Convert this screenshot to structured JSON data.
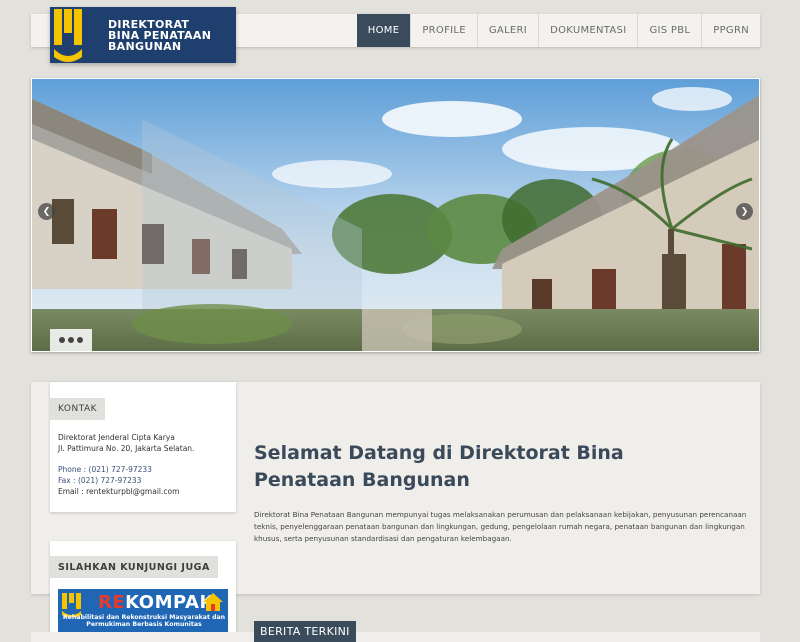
{
  "logo": {
    "line1": "DIREKTORAT",
    "line2": "BINA PENATAAN",
    "line3": "BANGUNAN",
    "colors": {
      "bg": "#1f3f6e",
      "mark": "#f5c400"
    }
  },
  "nav": {
    "items": [
      {
        "label": "HOME",
        "active": true
      },
      {
        "label": "PROFILE"
      },
      {
        "label": "GALERI"
      },
      {
        "label": "DOKUMENTASI"
      },
      {
        "label": "GIS PBL"
      },
      {
        "label": "PPGRN"
      }
    ]
  },
  "slider": {
    "prev_icon": "chevron-left-icon",
    "next_icon": "chevron-right-icon",
    "prev_glyph": "❮",
    "next_glyph": "❯",
    "slide_count": 3
  },
  "kontak": {
    "title": "KONTAK",
    "org": "Direktorat Jenderal Cipta Karya",
    "address": "Jl. Pattimura No. 20, Jakarta Selatan.",
    "phone": "Phone : (021) 727-97233",
    "fax": "Fax : (021) 727-97233",
    "email": "Email : rentekturpbl@gmail.com"
  },
  "kunjungi": {
    "title": "SILAHKAN KUNJUNGI JUGA",
    "banner": {
      "prefix": "RE",
      "name": "KOMPAK",
      "subtitle": "Rehabilitasi dan Rekonstruksi Masyarakat dan Permukiman Berbasis Komunitas"
    }
  },
  "main": {
    "welcome_title": "Selamat Datang di Direktorat Bina Penataan Bangunan",
    "welcome_body": "Direktorat Bina Penataan Bangunan mempunyai tugas melaksanakan perumusan dan pelaksanaan kebijakan, penyusunan perencanaan teknis, penyelenggaraan penataan bangunan dan lingkungan, gedung, pengelolaan rumah negara, penataan bangunan dan lingkungan khusus, serta penyusunan standardisasi dan pengaturan kelembagaan.",
    "news_heading": "BERITA TERKINI"
  },
  "colors": {
    "page_bg": "#e3e1dc",
    "nav_active": "#3a4c5c",
    "heading": "#3a4a5a"
  }
}
